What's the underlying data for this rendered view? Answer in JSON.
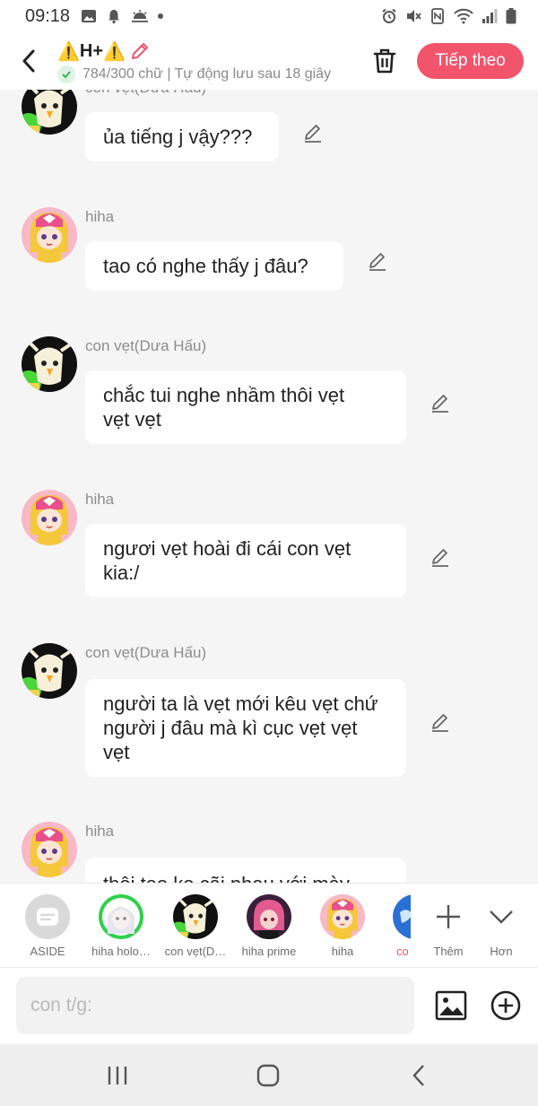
{
  "status_bar": {
    "time": "09:18",
    "left_icons": [
      "image-notification-icon",
      "bell-icon",
      "weather-icon",
      "dot-icon"
    ],
    "right_icons": [
      "alarm-icon",
      "mute-icon",
      "nfc-icon",
      "wifi-icon",
      "signal-icon",
      "battery-icon"
    ]
  },
  "header": {
    "title_warning_left": "⚠️",
    "title_text": "H+",
    "title_warning_right": "⚠️",
    "subtitle": "784/300 chữ | Tự động lưu sau 18 giây",
    "next_button": "Tiếp theo"
  },
  "messages": [
    {
      "sender": "con vẹt(Dưa Hấu)",
      "lines": [
        "ủa tiếng j vậy???"
      ],
      "avatar": "parrot"
    },
    {
      "sender": "hiha",
      "lines": [
        "tao có nghe thấy j đâu?"
      ],
      "avatar": "girl"
    },
    {
      "sender": "con vẹt(Dưa Hấu)",
      "lines": [
        "chắc tui nghe nhầm thôi vẹt",
        "vẹt vẹt"
      ],
      "avatar": "parrot"
    },
    {
      "sender": "hiha",
      "lines": [
        "ngươi vẹt hoài đi cái con vẹt",
        "kia:/"
      ],
      "avatar": "girl"
    },
    {
      "sender": "con vẹt(Dưa Hấu)",
      "lines": [
        "người ta là vẹt mới kêu vẹt chứ",
        "người j đâu mà kì cục vẹt vẹt",
        "vẹt"
      ],
      "avatar": "parrot"
    },
    {
      "sender": "hiha",
      "lines": [
        "thôi tao ko cãi nhau với mày nữa"
      ],
      "avatar": "girl"
    }
  ],
  "characters": [
    {
      "name": "ASIDE",
      "avatar": "aside"
    },
    {
      "name": "hiha holo…",
      "avatar": "holo"
    },
    {
      "name": "con vẹt(D…",
      "avatar": "parrot"
    },
    {
      "name": "hiha prime",
      "avatar": "prime"
    },
    {
      "name": "hiha",
      "avatar": "girl"
    },
    {
      "name": "co",
      "avatar": "earth"
    }
  ],
  "strip_actions": {
    "more_label": "Thêm",
    "expand_label": "Hơn"
  },
  "input": {
    "placeholder": "con t/g:",
    "value": ""
  },
  "colors": {
    "accent": "#f2546b",
    "background": "#f5f5f5",
    "bubble": "#ffffff",
    "sender": "#8d8d8d"
  }
}
